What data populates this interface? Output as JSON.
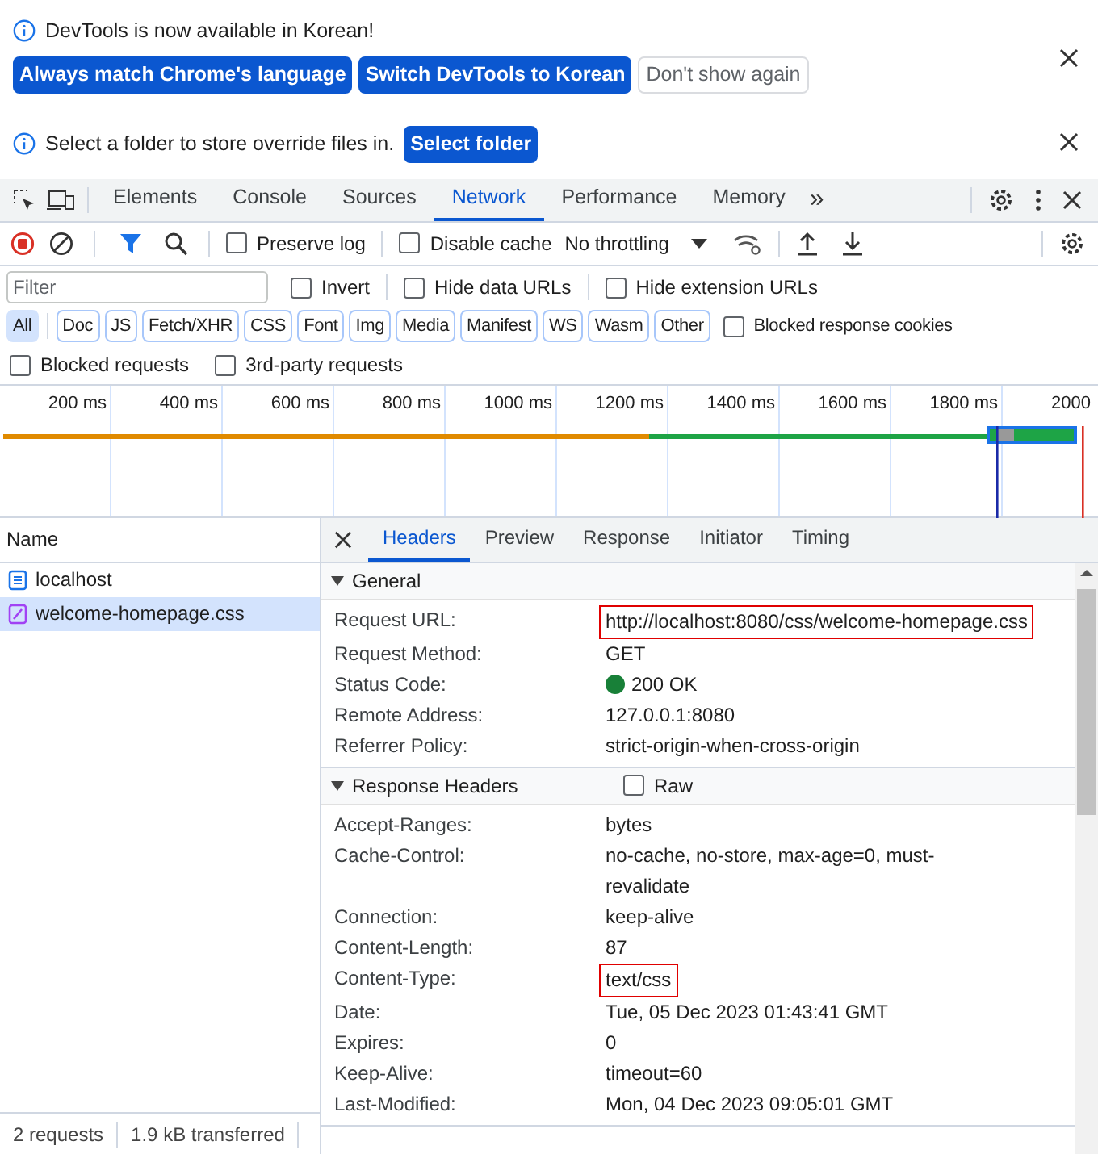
{
  "banners": [
    {
      "message": "DevTools is now available in Korean!",
      "buttons": [
        {
          "label": "Always match Chrome's language",
          "primary": true
        },
        {
          "label": "Switch DevTools to Korean",
          "primary": true
        },
        {
          "label": "Don't show again",
          "primary": false
        }
      ]
    },
    {
      "message": "Select a folder to store override files in.",
      "buttons": [
        {
          "label": "Select folder",
          "primary": true
        }
      ]
    }
  ],
  "panel_tabs": [
    {
      "label": "Elements",
      "selected": false
    },
    {
      "label": "Console",
      "selected": false
    },
    {
      "label": "Sources",
      "selected": false
    },
    {
      "label": "Network",
      "selected": true
    },
    {
      "label": "Performance",
      "selected": false
    },
    {
      "label": "Memory",
      "selected": false
    }
  ],
  "overflow_tabs": "»",
  "toolbar": {
    "recording": true,
    "filter_active": true,
    "preserve_log": {
      "label": "Preserve log",
      "checked": false
    },
    "disable_cache": {
      "label": "Disable cache",
      "checked": false
    },
    "throttling": "No throttling"
  },
  "filter": {
    "placeholder": "Filter",
    "options": [
      {
        "label": "Invert",
        "checked": false
      },
      {
        "label": "Hide data URLs",
        "checked": false
      },
      {
        "label": "Hide extension URLs",
        "checked": false
      }
    ]
  },
  "resource_types": [
    {
      "label": "All",
      "selected": true
    },
    {
      "label": "Doc",
      "selected": false
    },
    {
      "label": "JS",
      "selected": false
    },
    {
      "label": "Fetch/XHR",
      "selected": false
    },
    {
      "label": "CSS",
      "selected": false
    },
    {
      "label": "Font",
      "selected": false
    },
    {
      "label": "Img",
      "selected": false
    },
    {
      "label": "Media",
      "selected": false
    },
    {
      "label": "Manifest",
      "selected": false
    },
    {
      "label": "WS",
      "selected": false
    },
    {
      "label": "Wasm",
      "selected": false
    },
    {
      "label": "Other",
      "selected": false
    }
  ],
  "blocked_response_cookies": {
    "label": "Blocked response cookies",
    "checked": false
  },
  "more_options": [
    {
      "label": "Blocked requests",
      "checked": false
    },
    {
      "label": "3rd-party requests",
      "checked": false
    }
  ],
  "timeline": {
    "ticks": [
      "200 ms",
      "400 ms",
      "600 ms",
      "800 ms",
      "1000 ms",
      "1200 ms",
      "1400 ms",
      "1600 ms",
      "1800 ms",
      "2000"
    ]
  },
  "requests": {
    "column": "Name",
    "items": [
      {
        "name": "localhost",
        "kind": "document",
        "selected": false
      },
      {
        "name": "welcome-homepage.css",
        "kind": "stylesheet",
        "selected": true
      }
    ]
  },
  "detail_tabs": [
    {
      "label": "Headers",
      "selected": true
    },
    {
      "label": "Preview",
      "selected": false
    },
    {
      "label": "Response",
      "selected": false
    },
    {
      "label": "Initiator",
      "selected": false
    },
    {
      "label": "Timing",
      "selected": false
    }
  ],
  "sections": [
    {
      "title": "General",
      "expanded": true,
      "rows": [
        {
          "name": "Request URL:",
          "value": "http://localhost:8080/css/welcome-homepage.css",
          "highlighted": true
        },
        {
          "name": "Request Method:",
          "value": "GET",
          "highlighted": false
        },
        {
          "name": "Status Code:",
          "value": "200 OK",
          "color": "#188038",
          "highlighted": false
        },
        {
          "name": "Remote Address:",
          "value": "127.0.0.1:8080",
          "highlighted": false
        },
        {
          "name": "Referrer Policy:",
          "value": "strict-origin-when-cross-origin",
          "highlighted": false
        }
      ]
    },
    {
      "title": "Response Headers",
      "expanded": true,
      "raw": {
        "label": "Raw",
        "checked": false
      },
      "rows": [
        {
          "name": "Accept-Ranges:",
          "value": "bytes",
          "highlighted": false
        },
        {
          "name": "Cache-Control:",
          "value": "no-cache, no-store, max-age=0, must-revalidate",
          "highlighted": false
        },
        {
          "name": "Connection:",
          "value": "keep-alive",
          "highlighted": false
        },
        {
          "name": "Content-Length:",
          "value": "87",
          "highlighted": false
        },
        {
          "name": "Content-Type:",
          "value": "text/css",
          "highlighted": true
        },
        {
          "name": "Date:",
          "value": "Tue, 05 Dec 2023 01:43:41 GMT",
          "highlighted": false
        },
        {
          "name": "Expires:",
          "value": "0",
          "highlighted": false
        },
        {
          "name": "Keep-Alive:",
          "value": "timeout=60",
          "highlighted": false
        },
        {
          "name": "Last-Modified:",
          "value": "Mon, 04 Dec 2023 09:05:01 GMT",
          "highlighted": false
        }
      ]
    }
  ],
  "status_bar": [
    "2 requests",
    "1.9 kB transferred"
  ]
}
